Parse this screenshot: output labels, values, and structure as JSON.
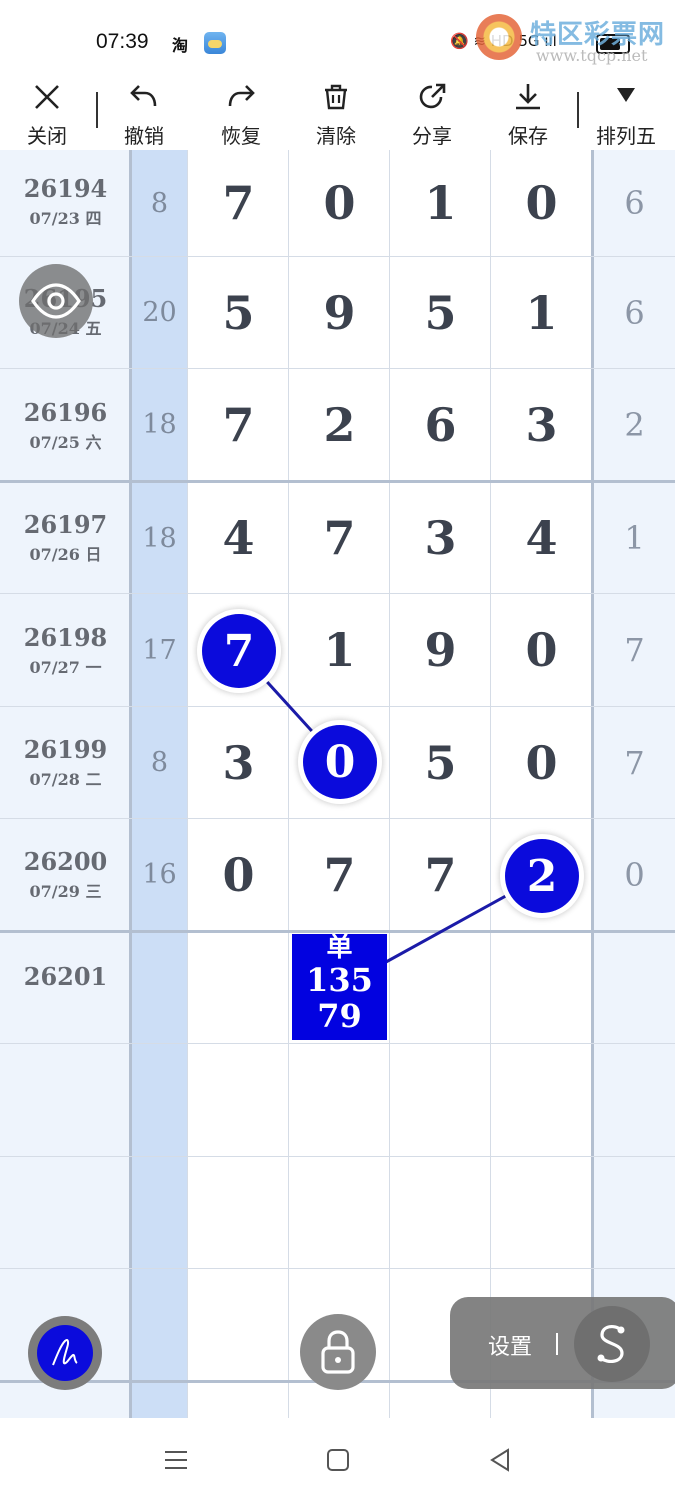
{
  "status_bar": {
    "time": "07:39",
    "taobao_icon": "淘",
    "icons_text": "🔕 ≋ HD 5G ııl"
  },
  "watermark": {
    "title": "特区彩票网",
    "url": "www.tqcp.net"
  },
  "toolbar": {
    "close": "关闭",
    "undo": "撤销",
    "redo": "恢复",
    "clear": "清除",
    "share": "分享",
    "save": "保存",
    "lottery": "排列五"
  },
  "rows": [
    {
      "issue": "26194",
      "date": "07/23 四",
      "sum": "8",
      "digits": [
        "7",
        "0",
        "1",
        "0"
      ],
      "last": "6"
    },
    {
      "issue": "26195",
      "date": "07/24 五",
      "sum": "20",
      "digits": [
        "5",
        "9",
        "5",
        "1"
      ],
      "last": "6"
    },
    {
      "issue": "26196",
      "date": "07/25 六",
      "sum": "18",
      "digits": [
        "7",
        "2",
        "6",
        "3"
      ],
      "last": "2"
    },
    {
      "issue": "26197",
      "date": "07/26 日",
      "sum": "18",
      "digits": [
        "4",
        "7",
        "3",
        "4"
      ],
      "last": "1"
    },
    {
      "issue": "26198",
      "date": "07/27 一",
      "sum": "17",
      "digits": [
        "7",
        "1",
        "9",
        "0"
      ],
      "last": "7"
    },
    {
      "issue": "26199",
      "date": "07/28 二",
      "sum": "8",
      "digits": [
        "3",
        "0",
        "5",
        "0"
      ],
      "last": "7"
    },
    {
      "issue": "26200",
      "date": "07/29 三",
      "sum": "16",
      "digits": [
        "0",
        "7",
        "7",
        "2"
      ],
      "last": "0"
    }
  ],
  "next_issue": "26201",
  "highlights": [
    {
      "row": 4,
      "col": 0
    },
    {
      "row": 5,
      "col": 1
    },
    {
      "row": 6,
      "col": 3
    }
  ],
  "prediction": {
    "label": "单",
    "line1": "135",
    "line2": "79"
  },
  "settings": {
    "label": "设置"
  },
  "colors": {
    "highlight": "#0b0bdc",
    "prediction_box": "#0202e0",
    "date_column": "#eef4fc",
    "sum_column": "#ccdef6"
  }
}
